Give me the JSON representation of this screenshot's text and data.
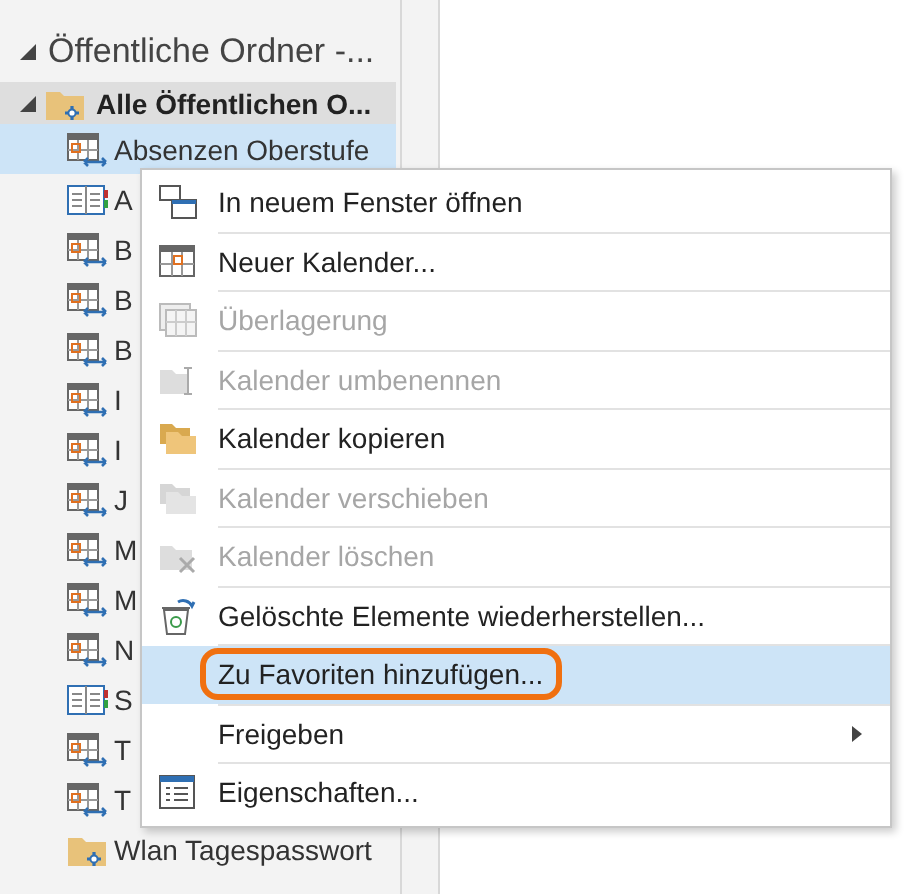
{
  "folder_tree": {
    "label": "Öffentliche Ordner -...",
    "expanded": true,
    "children": [
      {
        "label": "Alle Öffentlichen O...",
        "kind": "public-folder",
        "expanded": true,
        "selected": false,
        "children": [
          {
            "label": "Absenzen Oberstufe",
            "kind": "calendar",
            "selected": true
          },
          {
            "label": "A",
            "kind": "book",
            "selected": false
          },
          {
            "label": "B",
            "kind": "calendar",
            "selected": false
          },
          {
            "label": "B",
            "kind": "calendar",
            "selected": false
          },
          {
            "label": "B",
            "kind": "calendar",
            "selected": false
          },
          {
            "label": "I",
            "kind": "calendar",
            "selected": false
          },
          {
            "label": "I",
            "kind": "calendar",
            "selected": false
          },
          {
            "label": "J",
            "kind": "calendar",
            "selected": false
          },
          {
            "label": "M",
            "kind": "calendar",
            "selected": false
          },
          {
            "label": "M",
            "kind": "calendar",
            "selected": false
          },
          {
            "label": "N",
            "kind": "calendar",
            "selected": false
          },
          {
            "label": "S",
            "kind": "book",
            "selected": false
          },
          {
            "label": "T",
            "kind": "calendar",
            "selected": false
          },
          {
            "label": "T",
            "kind": "calendar",
            "selected": false
          },
          {
            "label": "Wlan Tagespasswort",
            "kind": "public-folder",
            "selected": false
          }
        ]
      }
    ]
  },
  "context_menu": [
    {
      "label": "In neuem Fenster öffnen",
      "disabled": false,
      "selected": false,
      "submenu": false
    },
    {
      "label": "Neuer Kalender...",
      "disabled": false,
      "selected": false,
      "submenu": false
    },
    {
      "label": "Überlagerung",
      "disabled": true,
      "selected": false,
      "submenu": false
    },
    {
      "label": "Kalender umbenennen",
      "disabled": true,
      "selected": false,
      "submenu": false
    },
    {
      "label": "Kalender kopieren",
      "disabled": false,
      "selected": false,
      "submenu": false
    },
    {
      "label": "Kalender verschieben",
      "disabled": true,
      "selected": false,
      "submenu": false
    },
    {
      "label": "Kalender löschen",
      "disabled": true,
      "selected": false,
      "submenu": false
    },
    {
      "label": "Gelöschte Elemente wiederherstellen...",
      "disabled": false,
      "selected": false,
      "submenu": false
    },
    {
      "label": "Zu Favoriten hinzufügen...",
      "disabled": false,
      "selected": true,
      "submenu": false
    },
    {
      "label": "Freigeben",
      "disabled": false,
      "selected": false,
      "submenu": true
    },
    {
      "label": "Eigenschaften...",
      "disabled": false,
      "selected": false,
      "submenu": false
    }
  ]
}
